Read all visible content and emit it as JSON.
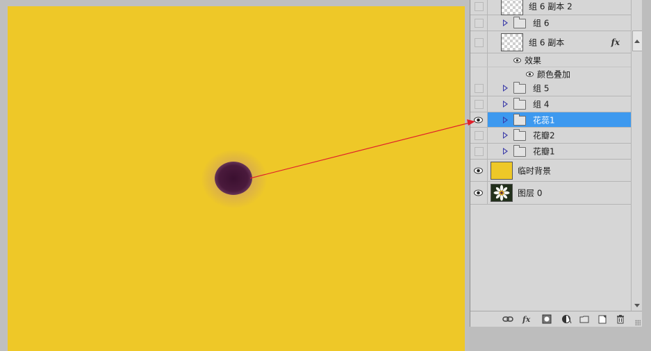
{
  "layers": [
    {
      "name": "组 6 副本 2",
      "type": "layer",
      "visible": false,
      "thumbnail": "transparent-checker"
    },
    {
      "name": "组 6",
      "type": "group",
      "visible": false
    },
    {
      "name": "组 6 副本",
      "type": "layer",
      "visible": false,
      "thumbnail": "transparent-checker",
      "fx": "fx"
    },
    {
      "name": "效果",
      "type": "effects-header",
      "visible": true
    },
    {
      "name": "颜色叠加",
      "type": "effect",
      "visible": true
    },
    {
      "name": "组 5",
      "type": "group",
      "visible": false
    },
    {
      "name": "组 4",
      "type": "group",
      "visible": false
    },
    {
      "name": "花蕊1",
      "type": "group",
      "visible": true,
      "selected": true
    },
    {
      "name": "花瓣2",
      "type": "group",
      "visible": false
    },
    {
      "name": "花瓣1",
      "type": "group",
      "visible": false
    },
    {
      "name": "临时背景",
      "type": "layer",
      "visible": true,
      "thumbnail": "yellow-fill"
    },
    {
      "name": "图层 0",
      "type": "layer",
      "visible": true,
      "thumbnail": "flower-photo"
    }
  ],
  "footer_icons": [
    "link-layers-icon",
    "fx-icon",
    "layer-mask-icon",
    "adjustment-layer-icon",
    "new-group-icon",
    "new-layer-icon",
    "delete-layer-icon"
  ],
  "colors": {
    "canvas": "#eec828",
    "selection": "#3d99ef",
    "arrow": "#e0202a",
    "panel": "#d6d6d6",
    "flower_core": "#4a1a3c"
  }
}
